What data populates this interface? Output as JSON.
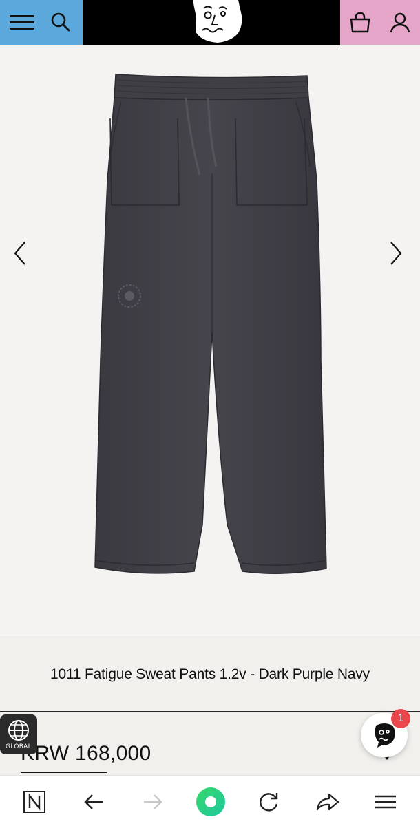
{
  "header": {
    "menu_icon": "hamburger-menu-icon",
    "search_icon": "search-icon",
    "logo_icon": "face-logo-icon",
    "bag_icon": "shopping-bag-icon",
    "user_icon": "user-account-icon",
    "colors": {
      "left_panel": "#5aa8dc",
      "right_panel": "#e6a6c9",
      "bar": "#000000"
    }
  },
  "gallery": {
    "image": "dark-sweat-pants-product-image",
    "prev_icon": "chevron-left-icon",
    "next_icon": "chevron-right-icon"
  },
  "product": {
    "title": "1011 Fatigue Sweat Pants 1.2v - Dark Purple Navy",
    "price": "KRW 168,000",
    "option_caret_icon": "caret-down-icon"
  },
  "global_button": {
    "icon": "globe-icon",
    "label": "GLOBAL"
  },
  "chat": {
    "icon": "face-chat-icon",
    "badge_count": "1",
    "badge_color": "#e9474b"
  },
  "browser_bar": {
    "items": [
      {
        "icon": "naver-n-icon"
      },
      {
        "icon": "back-arrow-icon"
      },
      {
        "icon": "forward-arrow-icon"
      },
      {
        "icon": "home-circle-icon",
        "color": "#1ec800"
      },
      {
        "icon": "refresh-icon"
      },
      {
        "icon": "share-icon"
      },
      {
        "icon": "menu-icon"
      }
    ]
  }
}
